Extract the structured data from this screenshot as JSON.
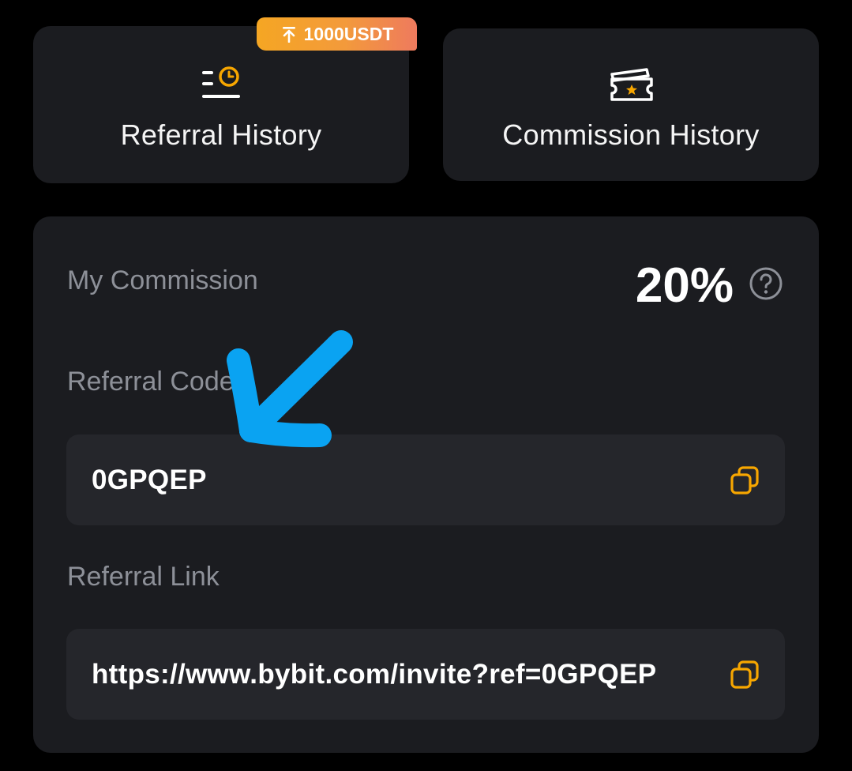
{
  "badge": {
    "label": "1000USDT"
  },
  "tiles": {
    "referral_history": {
      "label": "Referral History",
      "icon": "list-clock-icon"
    },
    "commission_history": {
      "label": "Commission History",
      "icon": "ticket-star-icon"
    }
  },
  "commission": {
    "label": "My Commission",
    "value": "20%"
  },
  "referral_code": {
    "label": "Referral Code",
    "value": "0GPQEP"
  },
  "referral_link": {
    "label": "Referral Link",
    "value": "https://www.bybit.com/invite?ref=0GPQEP"
  },
  "colors": {
    "background": "#000000",
    "card": "#1b1c20",
    "field": "#25262b",
    "accent": "#f7a600",
    "annotation_arrow": "#0aa3f2"
  }
}
